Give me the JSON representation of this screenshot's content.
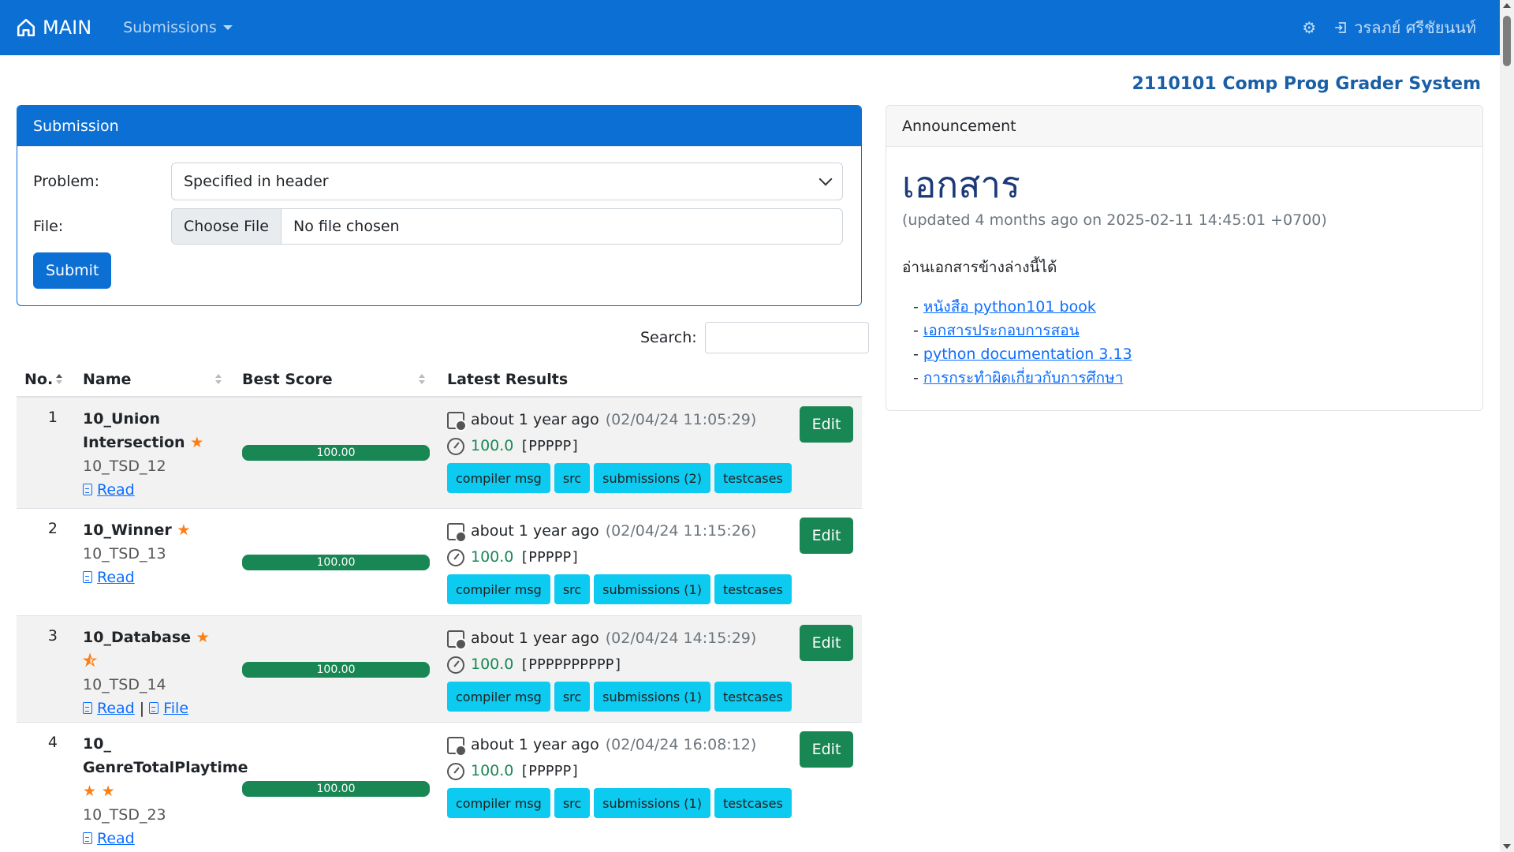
{
  "navbar": {
    "brand": "MAIN",
    "submissions_label": "Submissions",
    "user_name": "วรลภย์ ศรีชัยนนท์"
  },
  "site_title": "2110101 Comp Prog Grader System",
  "submission_form": {
    "header": "Submission",
    "problem_label": "Problem:",
    "problem_selected": "Specified in header",
    "file_label": "File:",
    "file_button": "Choose File",
    "file_status": "No file chosen",
    "submit_label": "Submit"
  },
  "search": {
    "label": "Search:",
    "value": ""
  },
  "table": {
    "headers": {
      "no": "No.",
      "name": "Name",
      "best_score": "Best Score",
      "latest_results": "Latest Results"
    },
    "rows": [
      {
        "no": "1",
        "name_line1": "10_Union",
        "name_line2": "Intersection",
        "stars": "★",
        "code": "10_TSD_12",
        "read": "Read",
        "file": "",
        "best_score": "100.00",
        "best_score_fraction": 1.0,
        "ago": "about 1 year ago",
        "timestamp": "(02/04/24 11:05:29)",
        "score": "100.0",
        "verdict": "[PPPPP]",
        "badges": [
          "compiler msg",
          "src",
          "submissions (2)",
          "testcases"
        ],
        "edit": "Edit"
      },
      {
        "no": "2",
        "name_line1": "10_Winner",
        "name_line2": "",
        "stars": "★",
        "code": "10_TSD_13",
        "read": "Read",
        "file": "",
        "best_score": "100.00",
        "best_score_fraction": 1.0,
        "ago": "about 1 year ago",
        "timestamp": "(02/04/24 11:15:26)",
        "score": "100.0",
        "verdict": "[PPPPP]",
        "badges": [
          "compiler msg",
          "src",
          "submissions (1)",
          "testcases"
        ],
        "edit": "Edit"
      },
      {
        "no": "3",
        "name_line1": "10_Database",
        "name_line2": "",
        "stars": "★ ⯪",
        "code": "10_TSD_14",
        "read": "Read",
        "file": "File",
        "best_score": "100.00",
        "best_score_fraction": 1.0,
        "ago": "about 1 year ago",
        "timestamp": "(02/04/24 14:15:29)",
        "score": "100.0",
        "verdict": "[PPPPPPPPPP]",
        "badges": [
          "compiler msg",
          "src",
          "submissions (1)",
          "testcases"
        ],
        "edit": "Edit"
      },
      {
        "no": "4",
        "name_line1": "10_",
        "name_line2": "GenreTotalPlaytime",
        "stars": "★ ★",
        "code": "10_TSD_23",
        "read": "Read",
        "file": "",
        "best_score": "100.00",
        "best_score_fraction": 1.0,
        "ago": "about 1 year ago",
        "timestamp": "(02/04/24 16:08:12)",
        "score": "100.0",
        "verdict": "[PPPPP]",
        "badges": [
          "compiler msg",
          "src",
          "submissions (1)",
          "testcases"
        ],
        "edit": "Edit"
      }
    ]
  },
  "announcement": {
    "header": "Announcement",
    "title": "เอกสาร",
    "updated": "(updated 4 months ago on 2025-02-11 14:45:01 +0700)",
    "intro": "อ่านเอกสารข้างล่างนี้ได้",
    "links": [
      "หนังสือ python101 book",
      "เอกสารประกอบการสอน",
      "python documentation 3.13",
      "การกระทำผิดเกี่ยวกับการศึกษา"
    ]
  },
  "colors": {
    "primary": "#0b6fd4",
    "success": "#198754",
    "info": "#0dcaf0",
    "star": "#fd7e14",
    "title": "#1a5fa6"
  }
}
